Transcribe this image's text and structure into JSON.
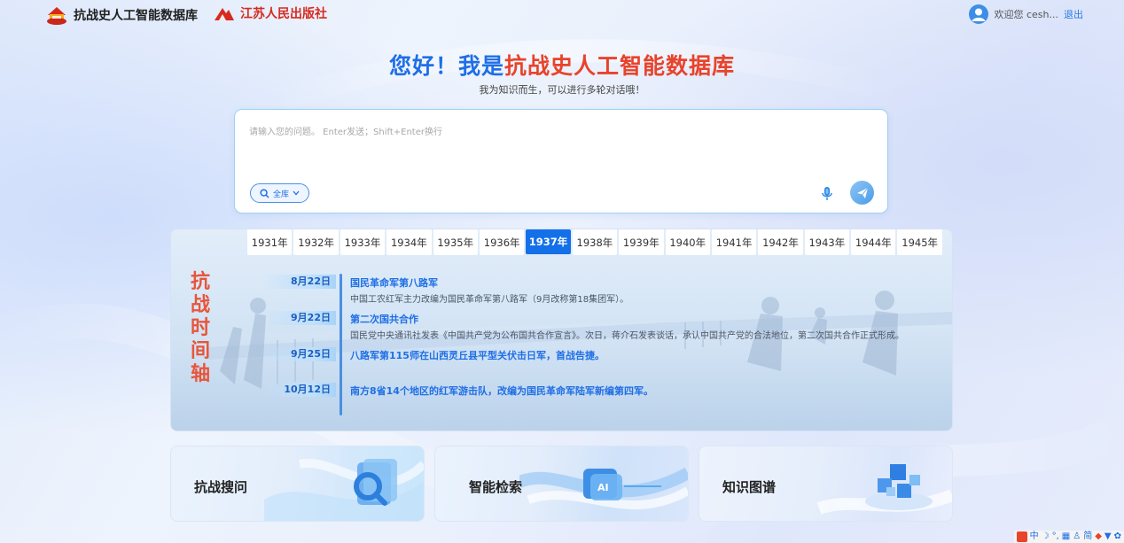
{
  "header": {
    "brand_name": "抗战史人工智能数据库",
    "publisher_name": "江苏人民出版社",
    "welcome_text": "欢迎您 cesh...",
    "logout_label": "退出"
  },
  "hero": {
    "title_prefix": "您好！我是",
    "title_highlight": "抗战史人工智能数据库",
    "subtitle": "我为知识而生，可以进行多轮对话哦！"
  },
  "ask": {
    "placeholder": "请输入您的问题。 Enter发送；Shift+Enter换行",
    "scope_label": "全库"
  },
  "timeline": {
    "vertical_title": [
      "抗",
      "战",
      "时",
      "间",
      "轴"
    ],
    "years": [
      "1931年",
      "1932年",
      "1933年",
      "1934年",
      "1935年",
      "1936年",
      "1937年",
      "1938年",
      "1939年",
      "1940年",
      "1941年",
      "1942年",
      "1943年",
      "1944年",
      "1945年"
    ],
    "active_year": "1937年",
    "events": [
      {
        "date": "8月22日",
        "title": "国民革命军第八路军",
        "desc": "中国工农红军主力改编为国民革命军第八路军（9月改称第18集团军）。"
      },
      {
        "date": "9月22日",
        "title": "第二次国共合作",
        "desc": "国民党中央通讯社发表《中国共产党为公布国共合作宣言》。次日，蒋介石发表谈话，承认中国共产党的合法地位，第二次国共合作正式形成。"
      },
      {
        "date": "9月25日",
        "title": "八路军第115师在山西灵丘县平型关伏击日军，首战告捷。",
        "desc": ""
      },
      {
        "date": "10月12日",
        "title": "南方8省14个地区的红军游击队，改编为国民革命军陆军新编第四军。",
        "desc": ""
      }
    ]
  },
  "cards": [
    {
      "label": "抗战搜问"
    },
    {
      "label": "智能检索"
    },
    {
      "label": "知识图谱"
    }
  ],
  "tray": {
    "items": [
      "中",
      "简"
    ]
  },
  "colors": {
    "accent_blue": "#1f6fe6",
    "accent_red": "#e8432b",
    "active_tab": "#1470e8"
  }
}
